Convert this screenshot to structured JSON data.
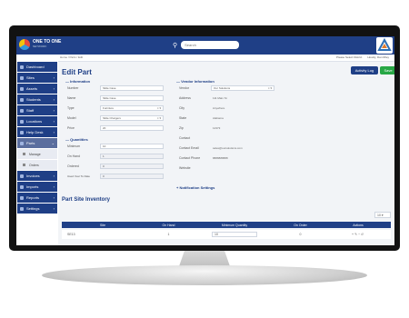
{
  "app": {
    "brand": "ONE TO ONE",
    "brand_sub": "NETWORK",
    "search_placeholder": "Search",
    "breadcrumb": "Home / Parts / Edit",
    "top_right": [
      "Please Select District",
      "Howdy, Dan Riley"
    ]
  },
  "sidebar": {
    "items": [
      {
        "label": "Dashboard"
      },
      {
        "label": "Sites"
      },
      {
        "label": "Assets"
      },
      {
        "label": "Students"
      },
      {
        "label": "Staff"
      },
      {
        "label": "Locations"
      },
      {
        "label": "Help Desk"
      },
      {
        "label": "Parts"
      },
      {
        "label": "Invoices"
      },
      {
        "label": "Imports"
      },
      {
        "label": "Reports"
      },
      {
        "label": "Settings"
      }
    ],
    "subitems": [
      {
        "label": "Manage"
      },
      {
        "label": "Orders"
      }
    ]
  },
  "page": {
    "title": "Edit Part",
    "activity_log": "Activity Log",
    "save": "Save"
  },
  "information": {
    "title": "Information",
    "fields": [
      {
        "label": "Number",
        "value": "Slide Case"
      },
      {
        "label": "Name",
        "value": "Slide Case"
      },
      {
        "label": "Type",
        "value": "Furniture"
      },
      {
        "label": "Model",
        "value": "Slide Chargers"
      },
      {
        "label": "Price",
        "value": "20"
      }
    ]
  },
  "quantities": {
    "title": "Quantities",
    "fields": [
      {
        "label": "Minimum",
        "value": "10"
      },
      {
        "label": "On Hand",
        "value": "1"
      },
      {
        "label": "Ordered",
        "value": "0"
      },
      {
        "label": "Used Year To Date",
        "value": "0"
      }
    ]
  },
  "vendor": {
    "title": "Vendor Information",
    "fields": [
      {
        "label": "Vendor",
        "value": "Our Solutions"
      },
      {
        "label": "Address",
        "value": "111 Main St"
      },
      {
        "label": "City",
        "value": "Anywhere"
      },
      {
        "label": "State",
        "value": "Alabama"
      },
      {
        "label": "Zip",
        "value": "12373"
      },
      {
        "label": "Contact",
        "value": ""
      },
      {
        "label": "Contact Email",
        "value": "sales@oursolutions.com"
      },
      {
        "label": "Contact Phone",
        "value": "8888888888"
      },
      {
        "label": "Website",
        "value": ""
      }
    ],
    "notification": "Notification Settings"
  },
  "inventory": {
    "title": "Part Site Inventory",
    "per_page": "10",
    "columns": [
      "Site",
      "On Hand",
      "Minimum Quantity",
      "On Order",
      "Actions"
    ],
    "rows": [
      {
        "site": "SE13",
        "on_hand": "1",
        "minimum": "10",
        "on_order": "0"
      }
    ]
  }
}
